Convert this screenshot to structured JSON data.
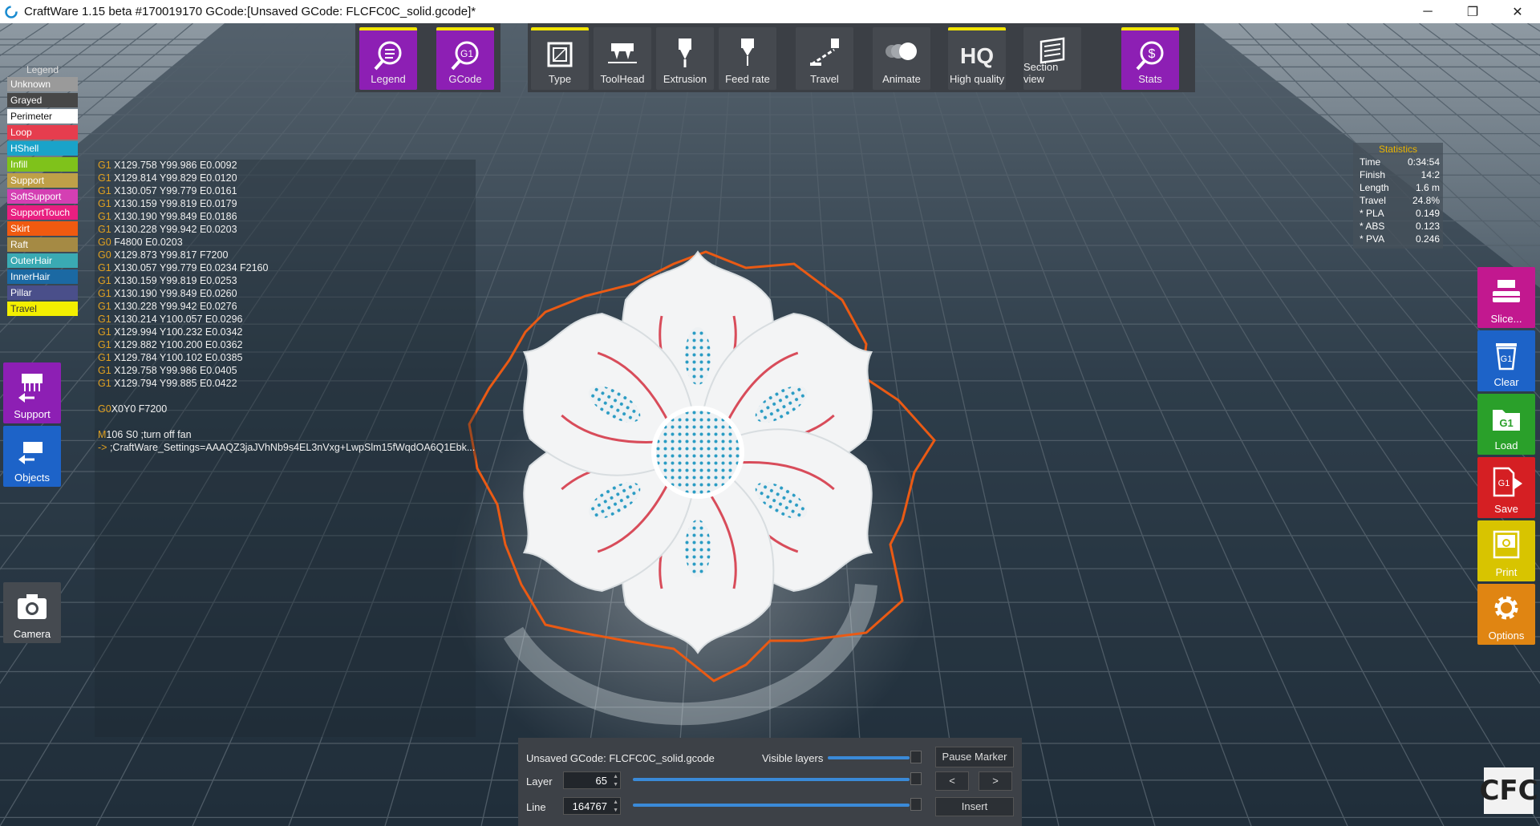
{
  "window": {
    "title": "CraftWare 1.15 beta #170019170   GCode:[Unsaved GCode: FLCFC0C_solid.gcode]*",
    "minimize": "─",
    "maximize": "❐",
    "close": "✕"
  },
  "legend": {
    "title": "Legend",
    "items": [
      {
        "label": "Unknown",
        "bg": "#9a9a9a",
        "fg": "#ffffff"
      },
      {
        "label": "Grayed",
        "bg": "#474747",
        "fg": "#ffffff"
      },
      {
        "label": "Perimeter",
        "bg": "#ffffff",
        "fg": "#111111"
      },
      {
        "label": "Loop",
        "bg": "#e63d4e",
        "fg": "#ffffff"
      },
      {
        "label": "HShell",
        "bg": "#1aa3c9",
        "fg": "#ffffff"
      },
      {
        "label": "Infill",
        "bg": "#7fc21b",
        "fg": "#ffffff"
      },
      {
        "label": "Support",
        "bg": "#bfa048",
        "fg": "#ffffff"
      },
      {
        "label": "SoftSupport",
        "bg": "#d43fb3",
        "fg": "#ffffff"
      },
      {
        "label": "SupportTouch",
        "bg": "#e91f80",
        "fg": "#ffffff"
      },
      {
        "label": "Skirt",
        "bg": "#f05a10",
        "fg": "#ffffff"
      },
      {
        "label": "Raft",
        "bg": "#a58a44",
        "fg": "#ffffff"
      },
      {
        "label": "OuterHair",
        "bg": "#3aaab3",
        "fg": "#ffffff"
      },
      {
        "label": "InnerHair",
        "bg": "#1b69a3",
        "fg": "#ffffff"
      },
      {
        "label": "Pillar",
        "bg": "#4a4f8a",
        "fg": "#ffffff"
      },
      {
        "label": "Travel",
        "bg": "#f3ef00",
        "fg": "#333333"
      }
    ]
  },
  "toolbar": {
    "legend": "Legend",
    "gcode": "GCode",
    "type": "Type",
    "toolhead": "ToolHead",
    "extrusion": "Extrusion",
    "feedrate": "Feed rate",
    "travel": "Travel",
    "animate": "Animate",
    "hq_glyph": "HQ",
    "highquality": "High quality",
    "sectionview": "Section view",
    "stats": "Stats"
  },
  "gcode_lines": [
    {
      "cmd": "G1",
      "text": " X129.758 Y99.986 E0.0092"
    },
    {
      "cmd": "G1",
      "text": " X129.814 Y99.829 E0.0120"
    },
    {
      "cmd": "G1",
      "text": " X130.057 Y99.779 E0.0161"
    },
    {
      "cmd": "G1",
      "text": " X130.159 Y99.819 E0.0179"
    },
    {
      "cmd": "G1",
      "text": " X130.190 Y99.849 E0.0186"
    },
    {
      "cmd": "G1",
      "text": " X130.228 Y99.942 E0.0203"
    },
    {
      "cmd": "G0",
      "text": " F4800 E0.0203"
    },
    {
      "cmd": "G0",
      "text": " X129.873 Y99.817 F7200"
    },
    {
      "cmd": "G1",
      "text": " X130.057 Y99.779 E0.0234 F2160"
    },
    {
      "cmd": "G1",
      "text": " X130.159 Y99.819 E0.0253"
    },
    {
      "cmd": "G1",
      "text": " X130.190 Y99.849 E0.0260"
    },
    {
      "cmd": "G1",
      "text": " X130.228 Y99.942 E0.0276"
    },
    {
      "cmd": "G1",
      "text": " X130.214 Y100.057 E0.0296"
    },
    {
      "cmd": "G1",
      "text": " X129.994 Y100.232 E0.0342"
    },
    {
      "cmd": "G1",
      "text": " X129.882 Y100.200 E0.0362"
    },
    {
      "cmd": "G1",
      "text": " X129.784 Y100.102 E0.0385"
    },
    {
      "cmd": "G1",
      "text": " X129.758 Y99.986 E0.0405"
    },
    {
      "cmd": "G1",
      "text": " X129.794 Y99.885 E0.0422"
    },
    {
      "cmd": "",
      "text": ""
    },
    {
      "cmd": "G0",
      "text": "X0Y0 F7200"
    },
    {
      "cmd": "",
      "text": ""
    },
    {
      "cmd": "M",
      "text": "106 S0 ;turn off fan"
    },
    {
      "cmd": "->",
      "text": " ;CraftWare_Settings=AAAQZ3jaJVhNb9s4EL3nVxg+LwpSlm15fWqdOA6Q1Ebk..."
    }
  ],
  "statistics": {
    "title": "Statistics",
    "rows": [
      {
        "label": "Time",
        "value": "0:34:54"
      },
      {
        "label": "Finish",
        "value": "14:2"
      },
      {
        "label": "Length",
        "value": "1.6 m"
      },
      {
        "label": "Travel",
        "value": "24.8%"
      },
      {
        "label": "* PLA",
        "value": "0.149"
      },
      {
        "label": "* ABS",
        "value": "0.123"
      },
      {
        "label": "* PVA",
        "value": "0.246"
      }
    ]
  },
  "left_buttons": {
    "support": "Support",
    "objects": "Objects",
    "camera": "Camera"
  },
  "right_buttons": {
    "slice": "Slice...",
    "clear": "Clear",
    "load": "Load",
    "save": "Save",
    "print": "Print",
    "options": "Options"
  },
  "bottom": {
    "filename": "Unsaved GCode: FLCFC0C_solid.gcode",
    "visible_layers": "Visible layers",
    "pause_marker": "Pause Marker",
    "layer_label": "Layer",
    "layer_value": "65",
    "line_label": "Line",
    "line_value": "164767",
    "prev": "<",
    "next": ">",
    "insert": "Insert"
  },
  "logo": "CFC"
}
